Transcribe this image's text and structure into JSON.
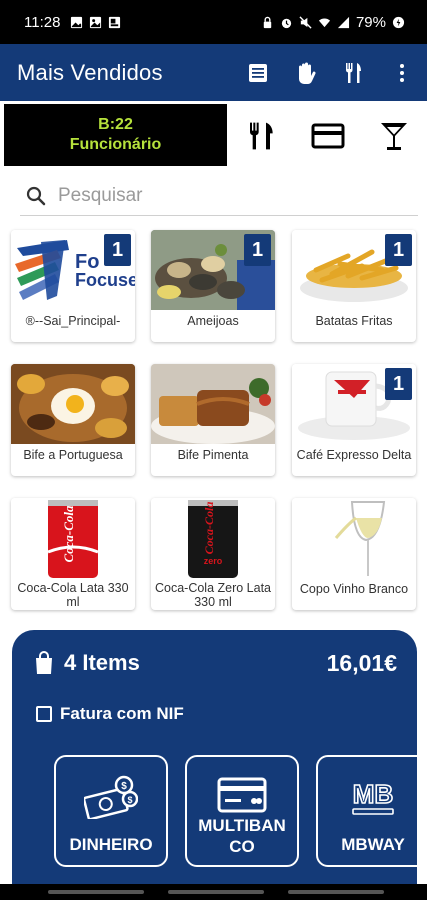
{
  "status_bar": {
    "time": "11:28",
    "battery": "79%"
  },
  "app_bar": {
    "title": "Mais Vendidos"
  },
  "table_box": {
    "line1": "B:22",
    "line2": "Funcionário"
  },
  "search": {
    "placeholder": "Pesquisar",
    "value": ""
  },
  "products": [
    {
      "name": "®--Sai_Principal-",
      "badge": "1"
    },
    {
      "name": "Ameijoas",
      "badge": "1"
    },
    {
      "name": "Batatas Fritas",
      "badge": "1"
    },
    {
      "name": "Bife a Portuguesa",
      "badge": ""
    },
    {
      "name": "Bife Pimenta",
      "badge": ""
    },
    {
      "name": "Café Expresso Delta",
      "badge": "1"
    },
    {
      "name": "Coca-Cola Lata 330 ml",
      "badge": ""
    },
    {
      "name": "Coca-Cola Zero Lata 330 ml",
      "badge": ""
    },
    {
      "name": "Copo Vinho Branco",
      "badge": ""
    }
  ],
  "product_image_text": {
    "logo_line1": "Fo",
    "logo_line2": "Focuse",
    "coca_cola": "Coca-Cola",
    "coca_zero": "zero"
  },
  "cart": {
    "items_label": "4 Items",
    "total": "16,01€",
    "nif_label": "Fatura com NIF",
    "payments": [
      {
        "label": "DINHEIRO"
      },
      {
        "label": "MULTIBAN CO"
      },
      {
        "label": "MBWAY"
      }
    ],
    "mb_text": "MB"
  },
  "colors": {
    "primary": "#143a78",
    "table_text": "#b6e23c",
    "background": "#ffffff"
  }
}
